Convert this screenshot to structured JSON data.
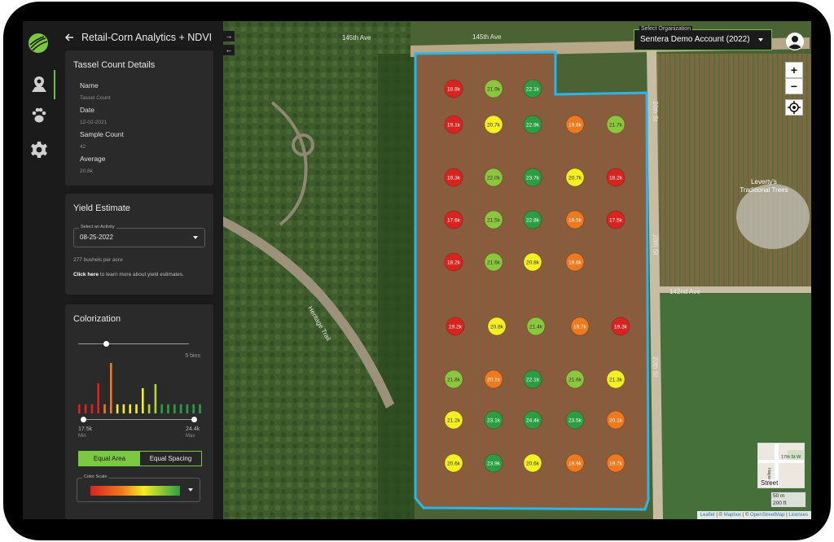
{
  "app": {
    "title": "Retail-Corn Analytics + NDVI"
  },
  "tassel": {
    "title": "Tassel Count Details",
    "name_label": "Name",
    "name_value": "Tassel Count",
    "date_label": "Date",
    "date_value": "12-02-2021",
    "sample_label": "Sample Count",
    "sample_value": "42",
    "avg_label": "Average",
    "avg_value": "20.8k"
  },
  "yield": {
    "title": "Yield Estimate",
    "select_legend": "Select an Activity",
    "select_value": "08-25-2022",
    "bushels": "277 bushels per acre",
    "link": "Click here",
    "link_rest": " to learn more about yield estimates."
  },
  "color": {
    "title": "Colorization",
    "bins_label": "5 bins",
    "bins_fraction": 0.25,
    "min_value": "17.5k",
    "min_label": "Min",
    "max_value": "24.4k",
    "max_label": "Max",
    "equal_area": "Equal Area",
    "equal_spacing": "Equal Spacing",
    "scale_legend": "Color Scale",
    "histogram": [
      {
        "c": "#d9231f",
        "h": 0.18
      },
      {
        "c": "#d9231f",
        "h": 0.18
      },
      {
        "c": "#d9231f",
        "h": 0.18
      },
      {
        "c": "#d9231f",
        "h": 0.6
      },
      {
        "c": "#ee7a1f",
        "h": 0.18
      },
      {
        "c": "#ee7a1f",
        "h": 1.0
      },
      {
        "c": "#f2ef22",
        "h": 0.18
      },
      {
        "c": "#f2ef22",
        "h": 0.18
      },
      {
        "c": "#f2ef22",
        "h": 0.18
      },
      {
        "c": "#f2ef22",
        "h": 0.18
      },
      {
        "c": "#f2ef22",
        "h": 0.5
      },
      {
        "c": "#b4d335",
        "h": 0.18
      },
      {
        "c": "#b4d335",
        "h": 0.58
      },
      {
        "c": "#2c9d43",
        "h": 0.18
      },
      {
        "c": "#2c9d43",
        "h": 0.18
      },
      {
        "c": "#2c9d43",
        "h": 0.18
      },
      {
        "c": "#2c9d43",
        "h": 0.18
      },
      {
        "c": "#2c9d43",
        "h": 0.18
      },
      {
        "c": "#2c9d43",
        "h": 0.18
      },
      {
        "c": "#2c9d43",
        "h": 0.18
      }
    ]
  },
  "map": {
    "org_legend": "Select Organization",
    "org_value": "Sentera Demo Account (2022)",
    "zoom_in": "+",
    "zoom_out": "−",
    "expand_arrow": "→",
    "collapse_arrow": "←",
    "roads": {
      "r145a": "145th Ave",
      "r145b": "145th Ave",
      "r20a": "20th St",
      "r20b": "20th St",
      "r20c": "20th St",
      "r142": "142nd Ave",
      "heritage": "Heritage Trail",
      "leverty1": "Leverty's",
      "leverty2": "Traditional Trees"
    },
    "minimap": {
      "street": "Street",
      "road1": "17th St W",
      "road2": "Hayward"
    },
    "scale_m": "50 m",
    "scale_ft": "200 ft",
    "attribution": {
      "leaflet": "Leaflet",
      "sep1": " | © ",
      "mapbox": "Mapbox",
      "sep2": " | © ",
      "osm": "OpenStreetMap",
      "sep3": " | ",
      "lic": "Licenses"
    }
  },
  "colors": {
    "red": "#d9231f",
    "orange": "#ee7a1f",
    "yellow": "#f2ef22",
    "lightgreen": "#8cc63f",
    "green": "#2c9d43",
    "accent": "#6cc04a",
    "boundary": "#29b6e8"
  },
  "samples": [
    {
      "r": 0,
      "c": 0,
      "v": "18.8k",
      "k": "red"
    },
    {
      "r": 0,
      "c": 1,
      "v": "21.9k",
      "k": "lightgreen"
    },
    {
      "r": 0,
      "c": 2,
      "v": "22.1k",
      "k": "green"
    },
    {
      "r": 1,
      "c": 0,
      "v": "19.1k",
      "k": "red"
    },
    {
      "r": 1,
      "c": 1,
      "v": "20.7k",
      "k": "yellow"
    },
    {
      "r": 1,
      "c": 2,
      "v": "22.9k",
      "k": "green"
    },
    {
      "r": 1,
      "c": 3,
      "v": "19.8k",
      "k": "orange"
    },
    {
      "r": 1,
      "c": 4,
      "v": "21.7k",
      "k": "lightgreen"
    },
    {
      "r": 2,
      "c": 0,
      "v": "19.3k",
      "k": "red"
    },
    {
      "r": 2,
      "c": 1,
      "v": "22.0k",
      "k": "lightgreen"
    },
    {
      "r": 2,
      "c": 2,
      "v": "23.7k",
      "k": "green"
    },
    {
      "r": 2,
      "c": 3,
      "v": "20.7k",
      "k": "yellow"
    },
    {
      "r": 2,
      "c": 4,
      "v": "18.2k",
      "k": "red"
    },
    {
      "r": 3,
      "c": 0,
      "v": "17.6k",
      "k": "red"
    },
    {
      "r": 3,
      "c": 1,
      "v": "21.5k",
      "k": "lightgreen"
    },
    {
      "r": 3,
      "c": 2,
      "v": "22.8k",
      "k": "green"
    },
    {
      "r": 3,
      "c": 3,
      "v": "19.5k",
      "k": "orange"
    },
    {
      "r": 3,
      "c": 4,
      "v": "17.5k",
      "k": "red"
    },
    {
      "r": 4,
      "c": 0,
      "v": "18.2k",
      "k": "red"
    },
    {
      "r": 4,
      "c": 1,
      "v": "21.6k",
      "k": "lightgreen"
    },
    {
      "r": 4,
      "c": 2,
      "v": "20.8k",
      "k": "yellow"
    },
    {
      "r": 4,
      "c": 3,
      "v": "19.6k",
      "k": "orange"
    },
    {
      "r": 5,
      "c": 0,
      "v": "19.2k",
      "k": "red"
    },
    {
      "r": 5,
      "c": 1,
      "v": "20.8k",
      "k": "yellow"
    },
    {
      "r": 5,
      "c": 2,
      "v": "21.4k",
      "k": "lightgreen"
    },
    {
      "r": 5,
      "c": 3,
      "v": "19.7k",
      "k": "orange"
    },
    {
      "r": 5,
      "c": 4,
      "v": "19.3k",
      "k": "red"
    },
    {
      "r": 6,
      "c": 0,
      "v": "21.8k",
      "k": "lightgreen"
    },
    {
      "r": 6,
      "c": 1,
      "v": "20.1k",
      "k": "orange"
    },
    {
      "r": 6,
      "c": 2,
      "v": "22.1k",
      "k": "green"
    },
    {
      "r": 6,
      "c": 3,
      "v": "21.6k",
      "k": "lightgreen"
    },
    {
      "r": 6,
      "c": 4,
      "v": "21.3k",
      "k": "yellow"
    },
    {
      "r": 7,
      "c": 0,
      "v": "21.2k",
      "k": "yellow"
    },
    {
      "r": 7,
      "c": 1,
      "v": "23.1k",
      "k": "green"
    },
    {
      "r": 7,
      "c": 2,
      "v": "24.4k",
      "k": "green"
    },
    {
      "r": 7,
      "c": 3,
      "v": "23.5k",
      "k": "green"
    },
    {
      "r": 7,
      "c": 4,
      "v": "20.1k",
      "k": "orange"
    },
    {
      "r": 8,
      "c": 0,
      "v": "20.6k",
      "k": "yellow"
    },
    {
      "r": 8,
      "c": 1,
      "v": "23.9k",
      "k": "green"
    },
    {
      "r": 8,
      "c": 2,
      "v": "20.6k",
      "k": "yellow"
    },
    {
      "r": 8,
      "c": 3,
      "v": "19.9k",
      "k": "orange"
    },
    {
      "r": 8,
      "c": 4,
      "v": "19.7k",
      "k": "orange"
    }
  ]
}
